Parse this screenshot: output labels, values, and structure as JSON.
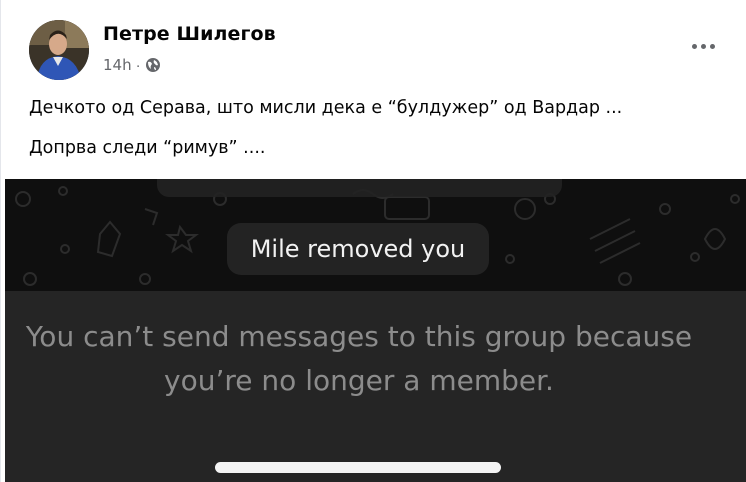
{
  "post": {
    "author": "Петре Шилегов",
    "time": "14h",
    "dot": "·",
    "privacy_icon": "globe-icon",
    "more_icon": "more-horizontal-icon",
    "text_lines": [
      "Дечкото од Серава, што мисли дека е “булдужер” од Вардар ...",
      "Допрва следи “римув” ...."
    ]
  },
  "screenshot": {
    "system_message": "Mile removed you",
    "notice_lines": [
      "You can’t send messages to this group because",
      "you’re no longer a member."
    ]
  },
  "colors": {
    "chat_background": "#0f0f0f",
    "notice_background": "#252525",
    "pill_background": "#232323",
    "notice_text": "#8c8c8c",
    "meta_text": "#65676b"
  }
}
